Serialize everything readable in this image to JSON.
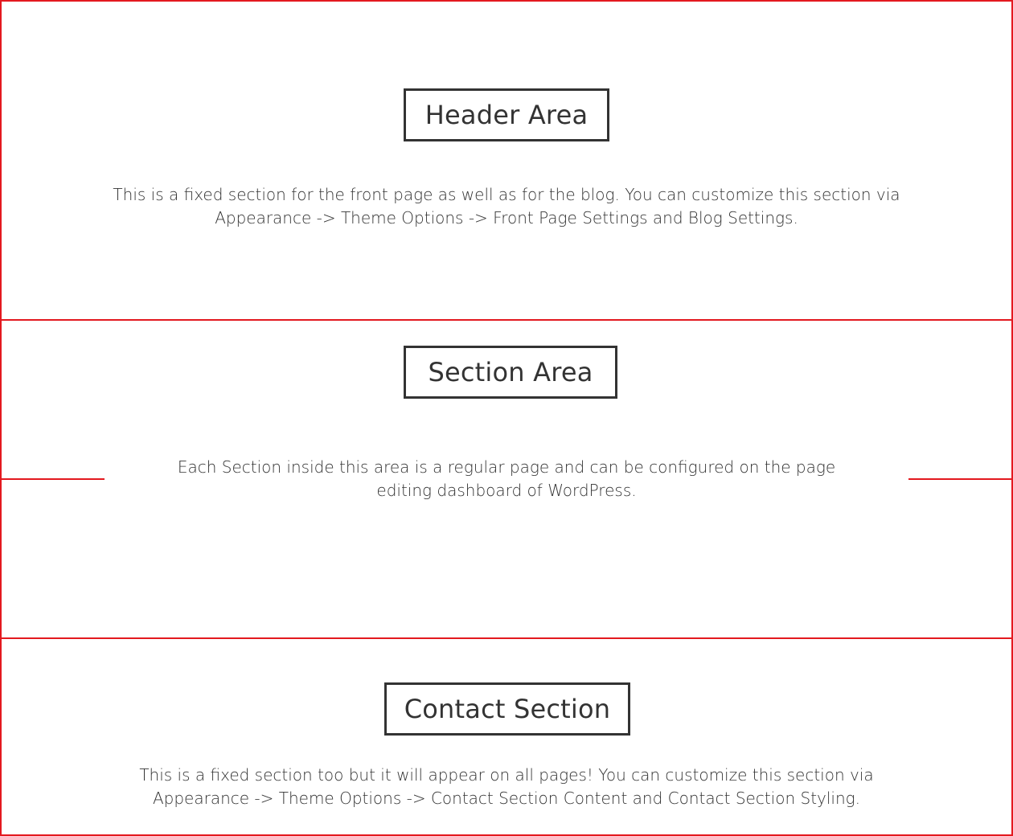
{
  "colors": {
    "border": "#e3191f",
    "text": "#333333",
    "background": "#ffffff"
  },
  "sections": {
    "header": {
      "title": "Header Area",
      "description_line1": "This is a fixed section for the front page as well as for the blog. You can customize this section via",
      "description_line2": "Appearance -> Theme Options -> Front Page Settings and Blog Settings."
    },
    "section": {
      "title": "Section Area",
      "description_line1": "Each Section inside this area is a regular page and can be configured on the page",
      "description_line2": "editing dashboard of WordPress."
    },
    "contact": {
      "title": "Contact Section",
      "description_line1": "This is a fixed section too but it will appear on all pages! You can customize this section via",
      "description_line2": "Appearance -> Theme Options -> Contact Section Content and Contact Section Styling."
    }
  }
}
